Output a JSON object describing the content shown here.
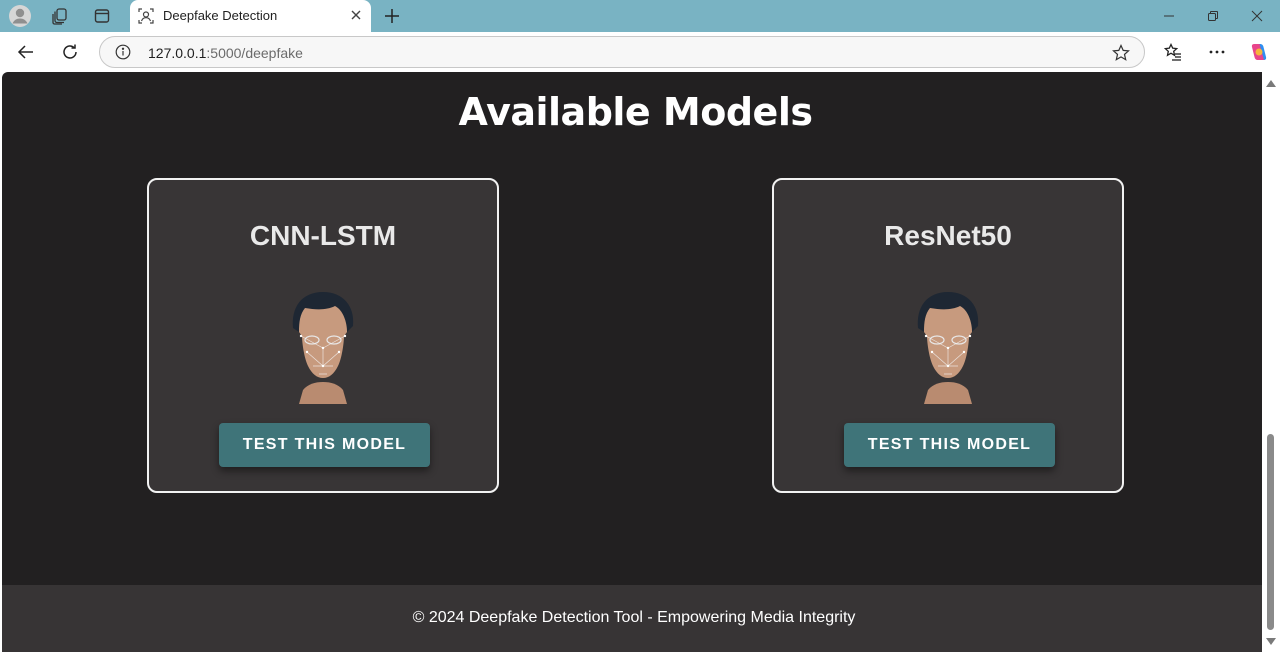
{
  "browser": {
    "tab": {
      "title": "Deepfake Detection"
    },
    "url_host": "127.0.0.1",
    "url_path": ":5000/deepfake",
    "accent_color": "#79b3c3"
  },
  "page": {
    "heading": "Available Models",
    "models": [
      {
        "name": "CNN-LSTM",
        "button_label": "TEST THIS MODEL"
      },
      {
        "name": "ResNet50",
        "button_label": "TEST THIS MODEL"
      }
    ],
    "footer": "© 2024 Deepfake Detection Tool - Empowering Media Integrity",
    "colors": {
      "background": "#222021",
      "card": "#383536",
      "button": "#3f7479",
      "footer": "#373435"
    }
  }
}
